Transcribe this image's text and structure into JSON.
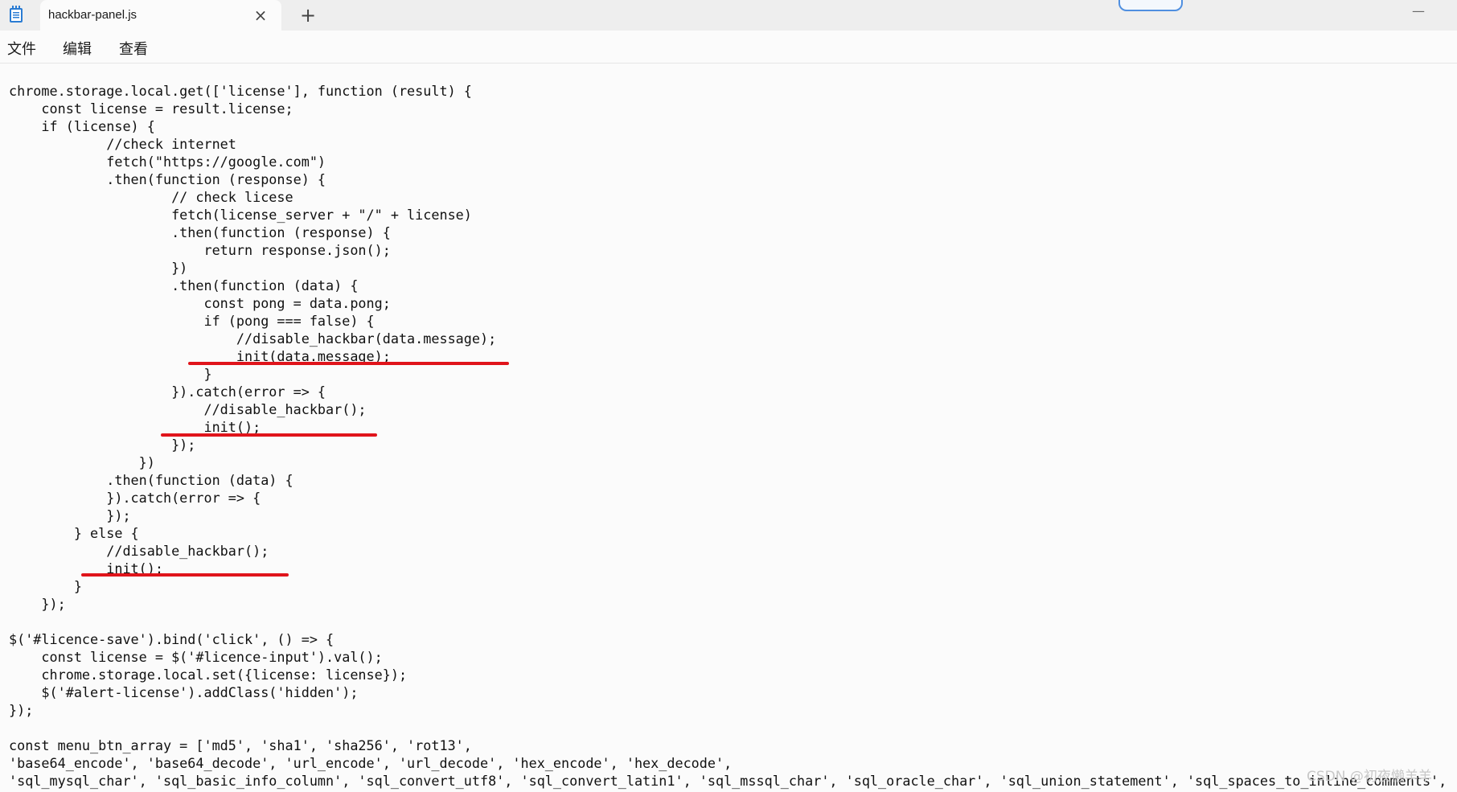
{
  "window": {
    "tab_title": "hackbar-panel.js",
    "close_glyph": "×",
    "new_tab_glyph": "+",
    "minimize_glyph": "—",
    "icons": {
      "app": "notepad-icon",
      "close": "close-icon",
      "new_tab": "plus-icon",
      "minimize": "minimize-icon"
    }
  },
  "menu": {
    "items": [
      "文件",
      "编辑",
      "查看"
    ]
  },
  "editor": {
    "lines": [
      "chrome.storage.local.get(['license'], function (result) {",
      "    const license = result.license;",
      "    if (license) {",
      "            //check internet",
      "            fetch(\"https://google.com\")",
      "            .then(function (response) {",
      "                    // check licese",
      "                    fetch(license_server + \"/\" + license)",
      "                    .then(function (response) {",
      "                        return response.json();",
      "                    })",
      "                    .then(function (data) {",
      "                        const pong = data.pong;",
      "                        if (pong === false) {",
      "                            //disable_hackbar(data.message);",
      "                            init(data.message);",
      "                        }",
      "                    }).catch(error => {",
      "                        //disable_hackbar();",
      "                        init();",
      "                    });",
      "                })",
      "            .then(function (data) {",
      "            }).catch(error => {",
      "            });",
      "        } else {",
      "            //disable_hackbar();",
      "            init();",
      "        }",
      "    });",
      "",
      "$('#licence-save').bind('click', () => {",
      "    const license = $('#licence-input').val();",
      "    chrome.storage.local.set({license: license});",
      "    $('#alert-license').addClass('hidden');",
      "});",
      "",
      "const menu_btn_array = ['md5', 'sha1', 'sha256', 'rot13',",
      "'base64_encode', 'base64_decode', 'url_encode', 'url_decode', 'hex_encode', 'hex_decode',",
      "'sql_mysql_char', 'sql_basic_info_column', 'sql_convert_utf8', 'sql_convert_latin1', 'sql_mssql_char', 'sql_oracle_char', 'sql_union_statement', 'sql_spaces_to_inline_comments',"
    ],
    "annotation_color": "#e0141b"
  },
  "watermark": "CSDN @初夜懒羊羊"
}
